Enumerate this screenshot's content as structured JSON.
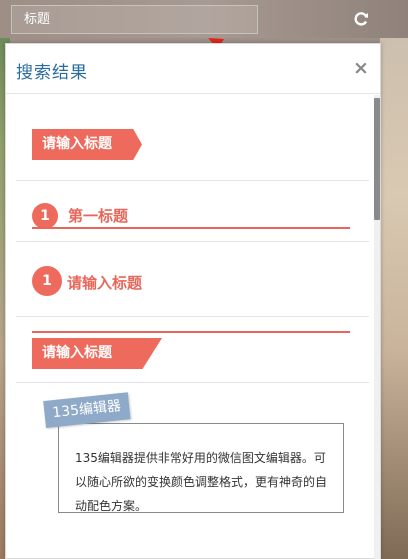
{
  "search": {
    "value": "标题"
  },
  "panel": {
    "title": "搜索结果",
    "close_symbol": "×"
  },
  "results": [
    {
      "style": "arrow-tag",
      "label": "请输入标题"
    },
    {
      "style": "numbered-underline",
      "number": "1",
      "label": "第一标题"
    },
    {
      "style": "numbered-plain",
      "number": "1",
      "label": "请输入标题"
    },
    {
      "style": "skew-tag-topline",
      "label": "请输入标题"
    },
    {
      "style": "card",
      "tag": "135编辑器",
      "text": "135编辑器提供非常好用的微信图文编辑器。可以随心所欲的变换颜色调整格式，更有神奇的自动配色方案。"
    }
  ],
  "colors": {
    "accent": "#ee6a5c",
    "title_blue": "#2a6c9e",
    "card_tag": "#8eaac8"
  },
  "icons": [
    "refresh-icon",
    "close-icon",
    "annotation-arrow-icon"
  ]
}
